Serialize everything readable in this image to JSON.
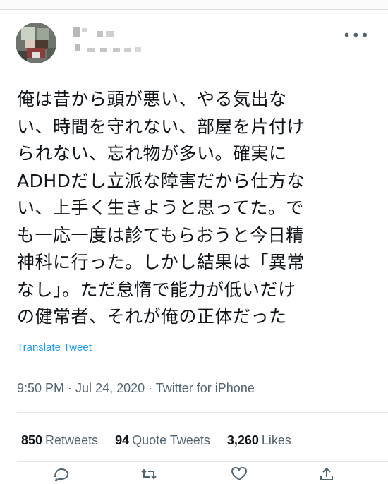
{
  "tweet": {
    "text": "俺は昔から頭が悪い、やる気出な\nい、時間を守れない、部屋を片付け\nられない、忘れ物が多い。確実に\nADHDだし立派な障害だから仕方な\nい、上手く生きようと思ってた。で\nも一応一度は診てもらおうと今日精\n神科に行った。しかし結果は「異常\nなし」。ただ怠惰で能力が低いだけ\nの健常者、それが俺の正体だった",
    "translate_label": "Translate Tweet",
    "meta": "9:50 PM · Jul 24, 2020 · Twitter for iPhone"
  },
  "stats": {
    "retweets_count": "850",
    "retweets_label": "Retweets",
    "quote_count": "94",
    "quote_label": "Quote Tweets",
    "likes_count": "3,260",
    "likes_label": "Likes"
  },
  "icons": {
    "more": "more-icon",
    "reply": "reply-icon",
    "retweet": "retweet-icon",
    "like": "heart-icon",
    "share": "share-icon"
  },
  "colors": {
    "link": "#1d9bf0",
    "muted": "#536471",
    "text": "#0f1419"
  }
}
